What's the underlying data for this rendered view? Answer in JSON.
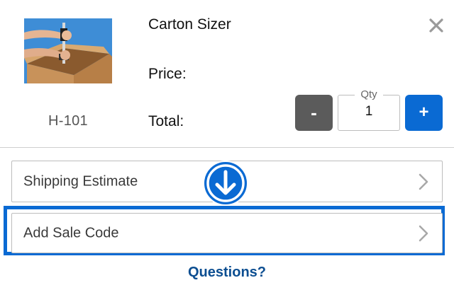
{
  "product": {
    "title": "Carton Sizer",
    "sku": "H-101",
    "price_label": "Price:",
    "total_label": "Total:",
    "image_icon": "carton-sizer-photo"
  },
  "quantity": {
    "label": "Qty",
    "value": "1",
    "minus_label": "-",
    "plus_label": "+"
  },
  "rows": {
    "shipping_estimate": "Shipping Estimate",
    "add_sale_code": "Add Sale Code"
  },
  "footer": {
    "questions": "Questions?"
  },
  "icons": {
    "close": "close-icon",
    "chevron": "chevron-right-icon",
    "arrow": "arrow-down-icon"
  },
  "colors": {
    "accent_blue": "#0a6ad3",
    "minus_gray": "#5b5b5b",
    "link_blue": "#0c4e91",
    "border": "#bdbdbd"
  }
}
